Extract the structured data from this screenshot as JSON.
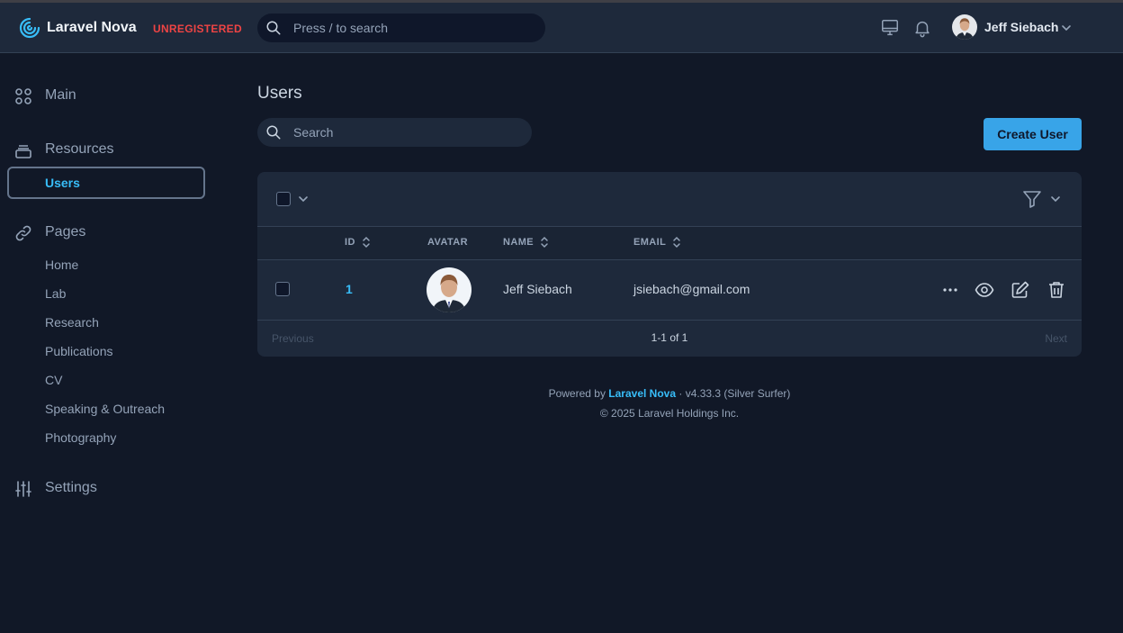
{
  "header": {
    "app_name": "Laravel Nova",
    "license_badge": "UNREGISTERED",
    "search_placeholder": "Press / to search",
    "user_name": "Jeff Siebach"
  },
  "sidebar": {
    "main_label": "Main",
    "resources_label": "Resources",
    "resources_items": [
      {
        "label": "Users"
      }
    ],
    "pages_label": "Pages",
    "pages_items": [
      {
        "label": "Home"
      },
      {
        "label": "Lab"
      },
      {
        "label": "Research"
      },
      {
        "label": "Publications"
      },
      {
        "label": "CV"
      },
      {
        "label": "Speaking & Outreach"
      },
      {
        "label": "Photography"
      }
    ],
    "settings_label": "Settings"
  },
  "main": {
    "title": "Users",
    "search_placeholder": "Search",
    "create_button": "Create User",
    "table": {
      "columns": [
        "ID",
        "AVATAR",
        "NAME",
        "EMAIL"
      ],
      "rows": [
        {
          "id": "1",
          "name": "Jeff Siebach",
          "email": "jsiebach@gmail.com"
        }
      ]
    },
    "pagination": {
      "previous": "Previous",
      "info": "1-1 of 1",
      "next": "Next"
    }
  },
  "footer": {
    "powered_prefix": "Powered by",
    "powered_brand": "Laravel Nova",
    "version": "· v4.33.3 (Silver Surfer)",
    "copyright": "© 2025 Laravel Holdings Inc."
  },
  "colors": {
    "background": "#111827",
    "header": "#1e293b",
    "accent": "#38bdf8",
    "primary_button": "#38a4e8",
    "danger": "#ef4444"
  },
  "icons": {
    "logo": "nova-spiral-icon",
    "search": "search-icon",
    "theme": "monitor-icon",
    "notifications": "bell-icon",
    "main": "grid-icon",
    "resources": "archive-icon",
    "pages": "link-icon",
    "settings": "sliders-icon",
    "filter": "filter-icon",
    "row_actions": [
      "more-icon",
      "eye-icon",
      "edit-icon",
      "trash-icon"
    ]
  }
}
